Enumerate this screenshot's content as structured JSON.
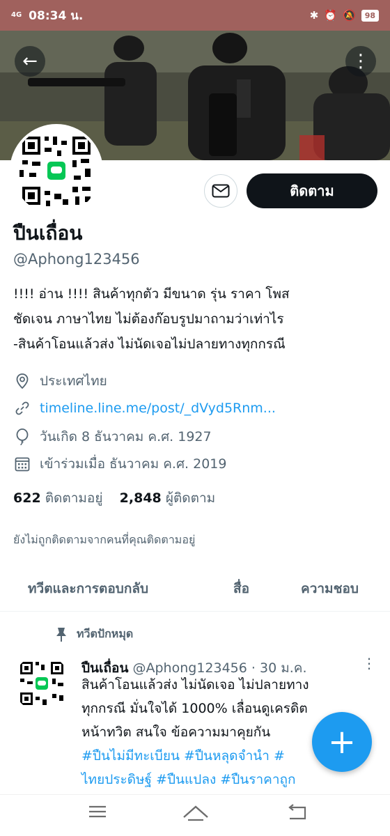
{
  "status_bar": {
    "network": "4G",
    "time": "08:34 น.",
    "battery": "98"
  },
  "profile": {
    "display_name": "ปืนเถื่อน",
    "handle": "@Aphong123456",
    "follow_label": "ติดตาม",
    "bio_lines": [
      "!!!! อ่าน !!!! สินค้าทุกตัว มีขนาด รุ่น ราคา โพส",
      "ชัดเจน ภาษาไทย ไม่ต้องก๊อบรูปมาถามว่าเท่าไร",
      "-สินค้าโอนแล้วส่ง ไม่นัดเจอไม่ปลายทางทุกกรณี"
    ],
    "location": "ประเทศไทย",
    "website": "timeline.line.me/post/_dVyd5Rnm...",
    "birthday": "วันเกิด 8 ธันวาคม ค.ศ. 1927",
    "joined": "เข้าร่วมเมื่อ ธันวาคม ค.ศ. 2019",
    "following_count": "622",
    "following_label": "ติดตามอยู่",
    "followers_count": "2,848",
    "followers_label": "ผู้ติดตาม",
    "not_followed_text": "ยังไม่ถูกติดตามจากคนที่คุณติดตามอยู่"
  },
  "tabs": [
    {
      "label": "ทวีตและการตอบกลับ"
    },
    {
      "label": "สื่อ"
    },
    {
      "label": "ความชอบ"
    }
  ],
  "pinned_tweet": {
    "pinned_label": "ทวีตปักหมุด",
    "author": "ปืนเถื่อน",
    "handle_date": "@Aphong123456 · 30 ม.ค.",
    "line1": "สินค้าโอนแล้วส่ง ไม่นัดเจอ ไม่ปลายทาง",
    "line2": "ทุกกรณี มั่นใจได้ 1000% เลื่อนดูเครดิต",
    "line3": "หน้าทวิต สนใจ ข้อความมาคุยกัน",
    "line4_tags": "#ปืนไม่มีทะเบียน #ปืนหลุดจำนำ #",
    "line5_tags": "ไทยประดิษฐ์ #ปืนแปลง #ปืนราคาถูก"
  },
  "colors": {
    "status_bar": "#a0615d",
    "accent": "#1d9bf0",
    "primary_text": "#0f1419",
    "secondary_text": "#536471"
  },
  "icons": {
    "back": "arrow-left-icon",
    "more": "more-vertical-icon",
    "mail": "envelope-icon",
    "location": "location-pin-icon",
    "link": "link-icon",
    "birthday": "balloon-icon",
    "calendar": "calendar-icon",
    "pin": "pin-icon",
    "compose": "plus-icon"
  }
}
